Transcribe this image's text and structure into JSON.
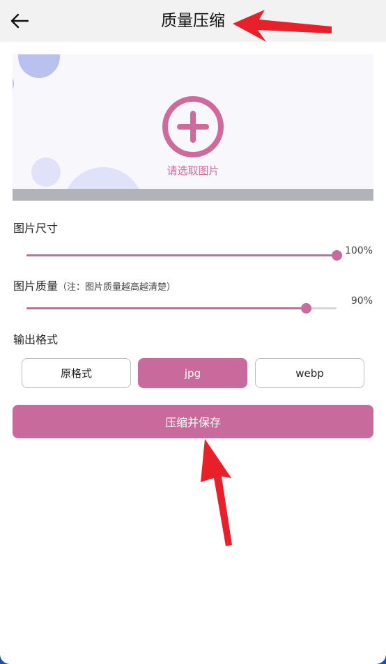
{
  "header": {
    "title": "质量压缩",
    "back_icon": "back-arrow-icon"
  },
  "picker": {
    "label": "请选取图片",
    "icon": "add-circle-icon"
  },
  "size_section": {
    "label": "图片尺寸",
    "value_text": "100%",
    "value": 100
  },
  "quality_section": {
    "label": "图片质量",
    "note": "（注：图片质量越高越清楚）",
    "value_text": "90%",
    "value": 90
  },
  "format_section": {
    "label": "输出格式",
    "options": [
      "原格式",
      "jpg",
      "webp"
    ],
    "selected_index": 1
  },
  "save_button": {
    "label": "压缩并保存"
  },
  "colors": {
    "accent": "#c96a9d",
    "header_bg": "#f2f2f2",
    "annotation_red": "#e8202a"
  }
}
